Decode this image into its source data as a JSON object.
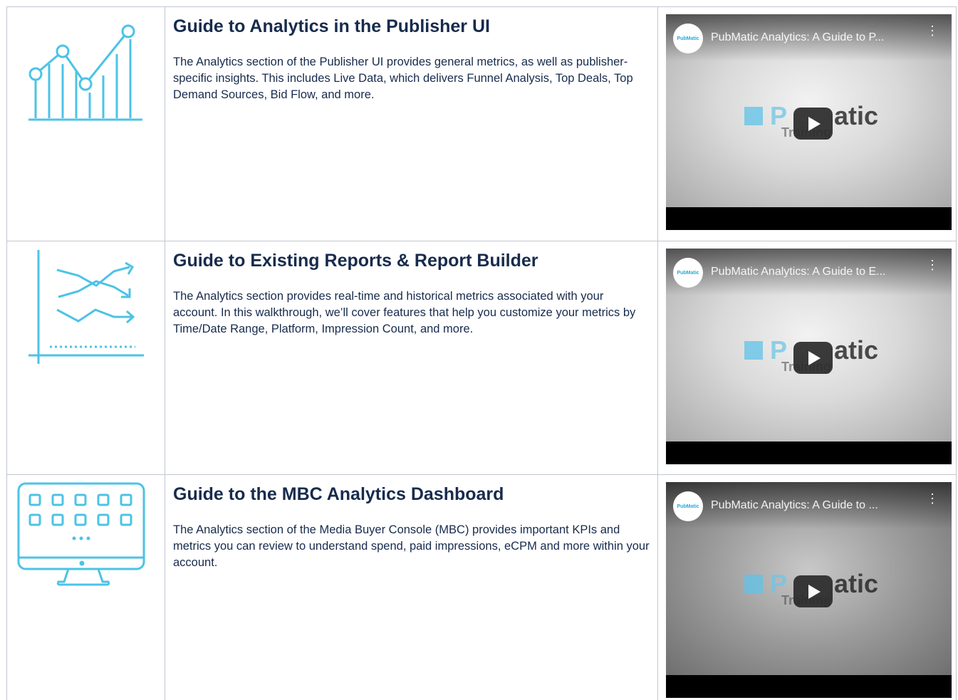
{
  "rows": [
    {
      "title": "Guide to Analytics in the Publisher UI",
      "description": "The Analytics section of the Publisher UI provides general metrics, as well as publisher-specific insights. This includes Live Data, which delivers Funnel Analysis, Top Deals, Top Demand Sources, Bid Flow, and more.",
      "icon": "line-chart-icon",
      "video": {
        "title": "PubMatic Analytics: A Guide to P...",
        "channel": "PubMatic",
        "logo_left": "P",
        "logo_right": "atic",
        "logo_sub": "Training"
      }
    },
    {
      "title": "Guide to Existing Reports & Report Builder",
      "description": "The Analytics section provides real-time and historical metrics associated with your account. In this walkthrough, we’ll cover features that help you customize your metrics by Time/Date Range, Platform, Impression Count, and more.",
      "icon": "trend-arrows-chart-icon",
      "video": {
        "title": "PubMatic Analytics: A Guide to E...",
        "channel": "PubMatic",
        "logo_left": "P",
        "logo_right": "atic",
        "logo_sub": "Training"
      }
    },
    {
      "title": "Guide to the MBC Analytics Dashboard",
      "description": "The Analytics section of the Media Buyer Console (MBC) provides important KPIs and metrics you can review to understand spend, paid impressions, eCPM and more within your account.",
      "icon": "monitor-dashboard-icon",
      "video": {
        "title": "PubMatic Analytics: A Guide to ...",
        "channel": "PubMatic",
        "logo_left": "P",
        "logo_right": "atic",
        "logo_sub": "Training"
      }
    }
  ],
  "colors": {
    "icon": "#4cc3e6",
    "border": "#c1c7d0",
    "text": "#172b4d"
  }
}
